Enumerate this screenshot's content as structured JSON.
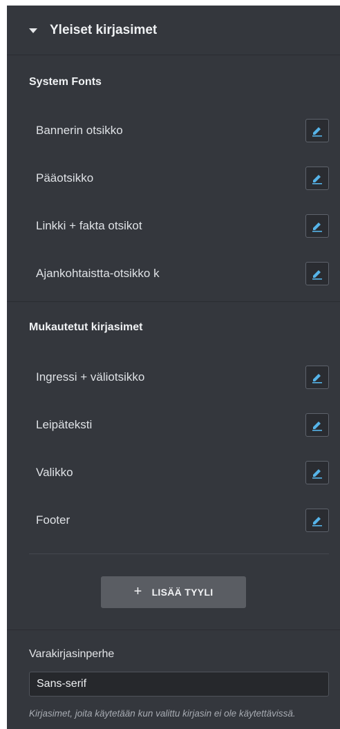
{
  "header": {
    "title": "Yleiset kirjasimet"
  },
  "system_fonts": {
    "title": "System Fonts",
    "items": [
      {
        "label": "Bannerin otsikko"
      },
      {
        "label": "Pääotsikko"
      },
      {
        "label": "Linkki + fakta otsikot"
      },
      {
        "label": "Ajankohtaistta-otsikko k"
      }
    ]
  },
  "custom_fonts": {
    "title": "Mukautetut kirjasimet",
    "items": [
      {
        "label": "Ingressi + väliotsikko"
      },
      {
        "label": "Leipäteksti"
      },
      {
        "label": "Valikko"
      },
      {
        "label": "Footer"
      }
    ]
  },
  "add_style": {
    "icon": "+",
    "label": "LISÄÄ TYYLI"
  },
  "fallback": {
    "label": "Varakirjasinperhe",
    "value": "Sans-serif",
    "note": "Kirjasimet, joita käytetään kun valittu kirjasin ei ole käytettävissä."
  },
  "colors": {
    "panel_bg": "#34373d",
    "edit_icon": "#56b4e9",
    "button_bg": "#5a5d63"
  },
  "icons": {
    "edit": "pencil-icon",
    "collapse": "caret-down-icon"
  }
}
